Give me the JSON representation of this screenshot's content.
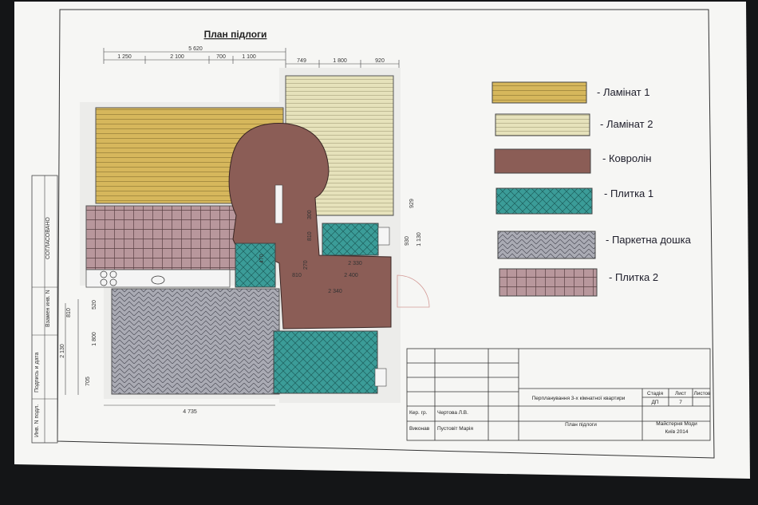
{
  "plan": {
    "title": "План підлоги",
    "dims_top_total": "5 620",
    "dims_top": [
      "1 250",
      "2 100",
      "700",
      "1 100"
    ],
    "dims_top_right": [
      "749",
      "1 800",
      "920"
    ],
    "dims_right": [
      "929",
      "930",
      "1 130"
    ],
    "dims_left": [
      "810",
      "520",
      "1 800",
      "2 130",
      "705"
    ],
    "dim_bottom": "4 735",
    "dims_inner": [
      "300",
      "810",
      "270",
      "470",
      "2 400",
      "2 330",
      "2 340",
      "810"
    ],
    "side_labels": [
      "СОГЛАСОВАНО",
      "Взамен инв. N",
      "Подпись и дата",
      "Инв. N подл."
    ]
  },
  "legend": [
    {
      "label": "- Ламінат 1",
      "material": "laminate-1"
    },
    {
      "label": "- Ламінат 2",
      "material": "laminate-2"
    },
    {
      "label": "- Ковролін",
      "material": "carpet"
    },
    {
      "label": "- Плитка 1",
      "material": "tile-1"
    },
    {
      "label": "- Паркетна дошка",
      "material": "parquet"
    },
    {
      "label": "- Плитка 2",
      "material": "tile-2"
    }
  ],
  "colors": {
    "laminate1": "#d4b65a",
    "laminate2": "#e4e0b8",
    "carpet": "#8b5d56",
    "tile1": "#3a9a96",
    "parquet": "#a9aab3",
    "tile2": "#b7969b"
  },
  "title_block": {
    "row1": {
      "role": "Кер. гр.",
      "name": "Чертова Л.В."
    },
    "row2": {
      "role": "Виконав",
      "name": "Пустовіт Марія"
    },
    "project": "Перпланування 3-х кімнатної квартири",
    "sheet_title": "План підлоги",
    "stage_header": "Стадія",
    "sheet_header": "Лист",
    "sheets_header": "Листов",
    "stage": "ДП",
    "sheet": "7",
    "org_line1": "Майстерня Моди",
    "org_line2": "Київ 2014"
  }
}
